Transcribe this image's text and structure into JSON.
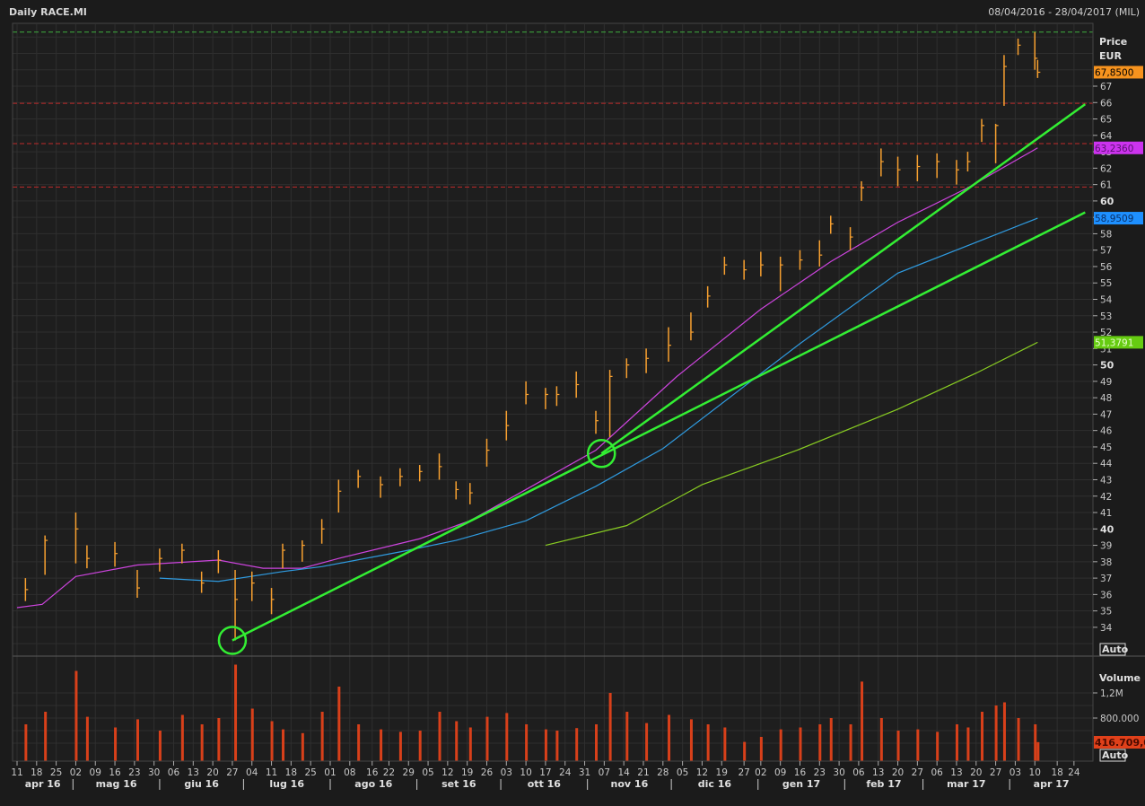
{
  "header": {
    "title": "Daily RACE.MI",
    "range": "08/04/2016 - 28/04/2017 (MIL)"
  },
  "price_axis": {
    "title_line1": "Price",
    "title_line2": "EUR",
    "auto_label": "Auto"
  },
  "volume_axis": {
    "title": "Volume",
    "ticks": [
      {
        "label": "1,2M",
        "value": 1200000
      },
      {
        "label": "800.000",
        "value": 800000
      }
    ],
    "auto_label": "Auto"
  },
  "badges": [
    {
      "label": "67,8500",
      "value": 67.85,
      "bg": "#f7931e",
      "fg": "#000000"
    },
    {
      "label": "63,2360",
      "value": 63.236,
      "bg": "#cc33ee",
      "fg": "#5a1070"
    },
    {
      "label": "58,9509",
      "value": 58.9509,
      "bg": "#1e90ff",
      "fg": "#0a2f66"
    },
    {
      "label": "51,3791",
      "value": 51.3791,
      "bg": "#66cc11",
      "fg": "#e8ffd0"
    }
  ],
  "volume_badge": {
    "label": "416.709,0",
    "bg": "#e0401a",
    "fg": "#4a0a00"
  },
  "colors": {
    "background": "#1e1e1e",
    "grid": "#2f2f2f",
    "price": "#f7a030",
    "volume": "#d8401a",
    "trendline": "#33ee33"
  },
  "chart_data": {
    "type": "ohlc",
    "ylim": [
      32.5,
      70.5
    ],
    "yticks": [
      34,
      35,
      36,
      37,
      38,
      39,
      40,
      41,
      42,
      43,
      44,
      45,
      46,
      47,
      48,
      49,
      50,
      51,
      52,
      53,
      54,
      55,
      56,
      57,
      58,
      59,
      60,
      61,
      62,
      63,
      64,
      65,
      66,
      67
    ],
    "ybold": [
      40,
      50,
      60
    ],
    "xlim": [
      "2016-04-09",
      "2017-04-28"
    ],
    "xticks": [
      {
        "label": "11",
        "date": "2016-04-11"
      },
      {
        "label": "18",
        "date": "2016-04-18"
      },
      {
        "label": "25",
        "date": "2016-04-25"
      },
      {
        "label": "02",
        "date": "2016-05-02"
      },
      {
        "label": "09",
        "date": "2016-05-09"
      },
      {
        "label": "16",
        "date": "2016-05-16"
      },
      {
        "label": "23",
        "date": "2016-05-23"
      },
      {
        "label": "30",
        "date": "2016-05-30"
      },
      {
        "label": "06",
        "date": "2016-06-06"
      },
      {
        "label": "13",
        "date": "2016-06-13"
      },
      {
        "label": "20",
        "date": "2016-06-20"
      },
      {
        "label": "27",
        "date": "2016-06-27"
      },
      {
        "label": "04",
        "date": "2016-07-04"
      },
      {
        "label": "11",
        "date": "2016-07-11"
      },
      {
        "label": "18",
        "date": "2016-07-18"
      },
      {
        "label": "25",
        "date": "2016-07-25"
      },
      {
        "label": "01",
        "date": "2016-08-01"
      },
      {
        "label": "08",
        "date": "2016-08-08"
      },
      {
        "label": "16",
        "date": "2016-08-16"
      },
      {
        "label": "22",
        "date": "2016-08-22"
      },
      {
        "label": "29",
        "date": "2016-08-29"
      },
      {
        "label": "05",
        "date": "2016-09-05"
      },
      {
        "label": "12",
        "date": "2016-09-12"
      },
      {
        "label": "19",
        "date": "2016-09-19"
      },
      {
        "label": "26",
        "date": "2016-09-26"
      },
      {
        "label": "03",
        "date": "2016-10-03"
      },
      {
        "label": "10",
        "date": "2016-10-10"
      },
      {
        "label": "17",
        "date": "2016-10-17"
      },
      {
        "label": "24",
        "date": "2016-10-24"
      },
      {
        "label": "31",
        "date": "2016-10-31"
      },
      {
        "label": "07",
        "date": "2016-11-07"
      },
      {
        "label": "14",
        "date": "2016-11-14"
      },
      {
        "label": "21",
        "date": "2016-11-21"
      },
      {
        "label": "28",
        "date": "2016-11-28"
      },
      {
        "label": "05",
        "date": "2016-12-05"
      },
      {
        "label": "12",
        "date": "2016-12-12"
      },
      {
        "label": "19",
        "date": "2016-12-19"
      },
      {
        "label": "27",
        "date": "2016-12-27"
      },
      {
        "label": "02",
        "date": "2017-01-02"
      },
      {
        "label": "09",
        "date": "2017-01-09"
      },
      {
        "label": "16",
        "date": "2017-01-16"
      },
      {
        "label": "23",
        "date": "2017-01-23"
      },
      {
        "label": "30",
        "date": "2017-01-30"
      },
      {
        "label": "06",
        "date": "2017-02-06"
      },
      {
        "label": "13",
        "date": "2017-02-13"
      },
      {
        "label": "20",
        "date": "2017-02-20"
      },
      {
        "label": "27",
        "date": "2017-02-27"
      },
      {
        "label": "06",
        "date": "2017-03-06"
      },
      {
        "label": "13",
        "date": "2017-03-13"
      },
      {
        "label": "20",
        "date": "2017-03-20"
      },
      {
        "label": "27",
        "date": "2017-03-27"
      },
      {
        "label": "03",
        "date": "2017-04-03"
      },
      {
        "label": "10",
        "date": "2017-04-10"
      },
      {
        "label": "18",
        "date": "2017-04-18"
      },
      {
        "label": "24",
        "date": "2017-04-24"
      }
    ],
    "months": [
      "apr 16",
      "mag 16",
      "giu 16",
      "lug 16",
      "ago 16",
      "set 16",
      "ott 16",
      "nov 16",
      "dic 16",
      "gen 17",
      "feb 17",
      "mar 17",
      "apr 17"
    ],
    "bars": [
      [
        "2016-04-14",
        35.6,
        37.0,
        36.3
      ],
      [
        "2016-04-21",
        37.2,
        39.6,
        39.3
      ],
      [
        "2016-05-02",
        37.9,
        41.0,
        40.0
      ],
      [
        "2016-05-06",
        37.6,
        39.0,
        38.2
      ],
      [
        "2016-05-16",
        37.7,
        39.2,
        38.5
      ],
      [
        "2016-05-24",
        35.8,
        37.5,
        36.4
      ],
      [
        "2016-06-01",
        37.4,
        38.8,
        38.2
      ],
      [
        "2016-06-09",
        37.9,
        39.1,
        38.7
      ],
      [
        "2016-06-16",
        36.1,
        37.4,
        36.7
      ],
      [
        "2016-06-22",
        37.3,
        38.7,
        38.1
      ],
      [
        "2016-06-28",
        33.2,
        37.5,
        35.7
      ],
      [
        "2016-07-04",
        35.6,
        37.4,
        36.7
      ],
      [
        "2016-07-11",
        34.8,
        36.4,
        35.7
      ],
      [
        "2016-07-15",
        37.6,
        39.1,
        38.7
      ],
      [
        "2016-07-22",
        38.0,
        39.3,
        39.0
      ],
      [
        "2016-07-29",
        39.1,
        40.6,
        40.0
      ],
      [
        "2016-08-04",
        41.0,
        43.0,
        42.3
      ],
      [
        "2016-08-11",
        42.5,
        43.6,
        43.2
      ],
      [
        "2016-08-19",
        41.9,
        43.2,
        42.7
      ],
      [
        "2016-08-26",
        42.6,
        43.7,
        43.2
      ],
      [
        "2016-09-02",
        42.9,
        43.9,
        43.5
      ],
      [
        "2016-09-09",
        43.0,
        44.6,
        43.8
      ],
      [
        "2016-09-15",
        41.8,
        42.9,
        42.4
      ],
      [
        "2016-09-20",
        41.5,
        42.8,
        42.2
      ],
      [
        "2016-09-26",
        43.8,
        45.5,
        44.8
      ],
      [
        "2016-10-03",
        45.4,
        47.2,
        46.3
      ],
      [
        "2016-10-10",
        47.6,
        49.0,
        48.2
      ],
      [
        "2016-10-17",
        47.3,
        48.6,
        48.2
      ],
      [
        "2016-10-21",
        47.5,
        48.7,
        48.2
      ],
      [
        "2016-10-28",
        48.0,
        49.6,
        48.8
      ],
      [
        "2016-11-04",
        45.8,
        47.2,
        46.6
      ],
      [
        "2016-11-09",
        45.6,
        49.7,
        49.3
      ],
      [
        "2016-11-15",
        49.2,
        50.4,
        50.0
      ],
      [
        "2016-11-22",
        49.5,
        51.0,
        50.4
      ],
      [
        "2016-11-30",
        50.2,
        52.3,
        51.2
      ],
      [
        "2016-12-08",
        51.5,
        53.2,
        52.0
      ],
      [
        "2016-12-14",
        53.5,
        54.8,
        54.2
      ],
      [
        "2016-12-20",
        55.5,
        56.6,
        56.1
      ],
      [
        "2016-12-27",
        55.2,
        56.4,
        55.8
      ],
      [
        "2017-01-02",
        55.4,
        56.9,
        56.1
      ],
      [
        "2017-01-09",
        54.5,
        56.6,
        56.1
      ],
      [
        "2017-01-16",
        55.8,
        57.0,
        56.4
      ],
      [
        "2017-01-23",
        56.0,
        57.6,
        56.7
      ],
      [
        "2017-01-27",
        58.0,
        59.1,
        58.6
      ],
      [
        "2017-02-03",
        57.0,
        58.4,
        57.8
      ],
      [
        "2017-02-07",
        60.0,
        61.2,
        60.8
      ],
      [
        "2017-02-14",
        61.5,
        63.2,
        62.4
      ],
      [
        "2017-02-20",
        60.9,
        62.7,
        61.9
      ],
      [
        "2017-02-27",
        61.2,
        62.8,
        62.1
      ],
      [
        "2017-03-06",
        61.4,
        62.9,
        62.4
      ],
      [
        "2017-03-13",
        61.0,
        62.5,
        61.9
      ],
      [
        "2017-03-17",
        61.8,
        63.0,
        62.4
      ],
      [
        "2017-03-22",
        63.6,
        65.0,
        64.6
      ],
      [
        "2017-03-27",
        62.3,
        64.7,
        64.6
      ],
      [
        "2017-03-30",
        65.8,
        68.9,
        68.2
      ],
      [
        "2017-04-04",
        68.9,
        69.9,
        69.5
      ],
      [
        "2017-04-10",
        68.0,
        70.3,
        68.7
      ],
      [
        "2017-04-11",
        67.5,
        68.6,
        67.85
      ]
    ],
    "moving_averages": [
      {
        "color": "#cc44dd",
        "last": 63.236,
        "points": [
          [
            "2016-04-11",
            35.2
          ],
          [
            "2016-04-20",
            35.4
          ],
          [
            "2016-05-02",
            37.1
          ],
          [
            "2016-05-24",
            37.8
          ],
          [
            "2016-06-22",
            38.1
          ],
          [
            "2016-07-08",
            37.6
          ],
          [
            "2016-07-22",
            37.6
          ],
          [
            "2016-08-04",
            38.2
          ],
          [
            "2016-09-02",
            39.4
          ],
          [
            "2016-09-20",
            40.5
          ],
          [
            "2016-10-10",
            42.4
          ],
          [
            "2016-11-04",
            44.8
          ],
          [
            "2016-12-03",
            49.3
          ],
          [
            "2017-01-02",
            53.4
          ],
          [
            "2017-01-27",
            56.3
          ],
          [
            "2017-02-20",
            58.7
          ],
          [
            "2017-03-17",
            60.8
          ],
          [
            "2017-04-11",
            63.236
          ]
        ]
      },
      {
        "color": "#2f9be0",
        "last": 58.9509,
        "points": [
          [
            "2016-06-01",
            37.0
          ],
          [
            "2016-06-22",
            36.8
          ],
          [
            "2016-07-15",
            37.4
          ],
          [
            "2016-07-29",
            37.7
          ],
          [
            "2016-08-26",
            38.6
          ],
          [
            "2016-09-15",
            39.3
          ],
          [
            "2016-10-10",
            40.5
          ],
          [
            "2016-11-04",
            42.6
          ],
          [
            "2016-11-28",
            44.9
          ],
          [
            "2017-01-16",
            51.3
          ],
          [
            "2017-02-20",
            55.6
          ],
          [
            "2017-04-11",
            58.9509
          ]
        ]
      },
      {
        "color": "#88cc22",
        "last": 51.3791,
        "points": [
          [
            "2016-10-17",
            39.0
          ],
          [
            "2016-11-15",
            40.2
          ],
          [
            "2016-12-12",
            42.7
          ],
          [
            "2017-01-15",
            44.8
          ],
          [
            "2017-02-20",
            47.3
          ],
          [
            "2017-03-20",
            49.5
          ],
          [
            "2017-04-11",
            51.3791
          ]
        ]
      }
    ],
    "trendlines": [
      {
        "from": [
          "2016-06-27",
          33.2
        ],
        "to": [
          "2017-04-28",
          59.3
        ]
      },
      {
        "from": [
          "2016-11-06",
          44.6
        ],
        "to": [
          "2017-04-28",
          65.9
        ]
      }
    ],
    "circles": [
      [
        "2016-06-27",
        33.2
      ],
      [
        "2016-11-06",
        44.6
      ]
    ],
    "hlines": [
      {
        "value": 70.3,
        "color": "#3fae3f"
      },
      {
        "value": 65.95,
        "color": "#c02a2a"
      },
      {
        "value": 63.5,
        "color": "#c02a2a"
      },
      {
        "value": 60.85,
        "color": "#c02a2a"
      }
    ],
    "volume": [
      [
        "2016-04-14",
        700000
      ],
      [
        "2016-04-21",
        900000
      ],
      [
        "2016-05-02",
        1550000
      ],
      [
        "2016-05-06",
        820000
      ],
      [
        "2016-05-16",
        650000
      ],
      [
        "2016-05-24",
        780000
      ],
      [
        "2016-06-01",
        600000
      ],
      [
        "2016-06-09",
        850000
      ],
      [
        "2016-06-16",
        700000
      ],
      [
        "2016-06-22",
        800000
      ],
      [
        "2016-06-28",
        1650000
      ],
      [
        "2016-07-04",
        950000
      ],
      [
        "2016-07-11",
        750000
      ],
      [
        "2016-07-15",
        620000
      ],
      [
        "2016-07-22",
        560000
      ],
      [
        "2016-07-29",
        900000
      ],
      [
        "2016-08-04",
        1300000
      ],
      [
        "2016-08-11",
        700000
      ],
      [
        "2016-08-19",
        620000
      ],
      [
        "2016-08-26",
        580000
      ],
      [
        "2016-09-02",
        600000
      ],
      [
        "2016-09-09",
        900000
      ],
      [
        "2016-09-15",
        750000
      ],
      [
        "2016-09-20",
        650000
      ],
      [
        "2016-09-26",
        820000
      ],
      [
        "2016-10-03",
        880000
      ],
      [
        "2016-10-10",
        700000
      ],
      [
        "2016-10-17",
        620000
      ],
      [
        "2016-10-21",
        600000
      ],
      [
        "2016-10-28",
        640000
      ],
      [
        "2016-11-04",
        700000
      ],
      [
        "2016-11-09",
        1200000
      ],
      [
        "2016-11-15",
        900000
      ],
      [
        "2016-11-22",
        720000
      ],
      [
        "2016-11-30",
        850000
      ],
      [
        "2016-12-08",
        780000
      ],
      [
        "2016-12-14",
        700000
      ],
      [
        "2016-12-20",
        650000
      ],
      [
        "2016-12-27",
        420000
      ],
      [
        "2017-01-02",
        500000
      ],
      [
        "2017-01-09",
        620000
      ],
      [
        "2017-01-16",
        650000
      ],
      [
        "2017-01-23",
        700000
      ],
      [
        "2017-01-27",
        800000
      ],
      [
        "2017-02-03",
        700000
      ],
      [
        "2017-02-07",
        1380000
      ],
      [
        "2017-02-14",
        800000
      ],
      [
        "2017-02-20",
        600000
      ],
      [
        "2017-02-27",
        620000
      ],
      [
        "2017-03-06",
        580000
      ],
      [
        "2017-03-13",
        700000
      ],
      [
        "2017-03-17",
        650000
      ],
      [
        "2017-03-22",
        900000
      ],
      [
        "2017-03-27",
        1000000
      ],
      [
        "2017-03-30",
        1050000
      ],
      [
        "2017-04-04",
        800000
      ],
      [
        "2017-04-10",
        700000
      ],
      [
        "2017-04-11",
        416709
      ]
    ]
  }
}
